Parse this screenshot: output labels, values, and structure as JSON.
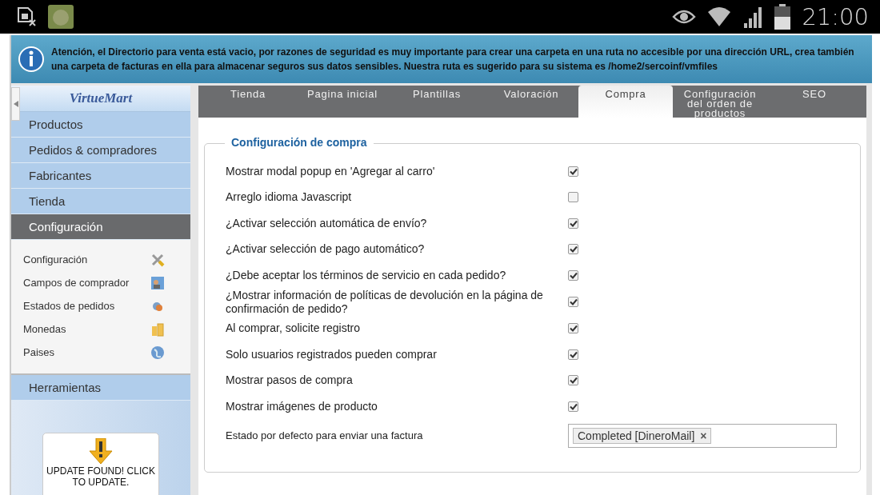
{
  "status_bar": {
    "time": "21:00"
  },
  "notice": {
    "text": "Atención, el Directorio para venta está vacio, por razones de seguridad es muy importante para crear una carpeta en una ruta no accesible por una dirección URL, crea también una carpeta de facturas en ella para almacenar seguros sus datos sensibles. Nuestra ruta es sugerido para su sistema es /home2/sercoinf/vmfiles"
  },
  "sidebar": {
    "logo": "VirtueMart",
    "items": [
      {
        "label": "Productos",
        "selected": false
      },
      {
        "label": "Pedidos & compradores",
        "selected": false
      },
      {
        "label": "Fabricantes",
        "selected": false
      },
      {
        "label": "Tienda",
        "selected": false
      },
      {
        "label": "Configuración",
        "selected": true,
        "children": [
          {
            "label": "Configuración"
          },
          {
            "label": "Campos de comprador"
          },
          {
            "label": "Estados de pedidos"
          },
          {
            "label": "Monedas"
          },
          {
            "label": "Paises"
          }
        ]
      },
      {
        "label": "Herramientas",
        "selected": false
      }
    ],
    "update": {
      "text": "UPDATE FOUND! CLICK TO UPDATE."
    }
  },
  "tabs": [
    {
      "label": "Tienda",
      "selected": false
    },
    {
      "label": "Pagina inicial",
      "selected": false
    },
    {
      "label": "Plantillas",
      "selected": false
    },
    {
      "label": "Valoración",
      "selected": false
    },
    {
      "label": "Compra",
      "selected": true
    },
    {
      "label": "Configuración del orden de productos",
      "selected": false
    },
    {
      "label": "SEO",
      "selected": false
    }
  ],
  "section": {
    "title": "Configuración de compra",
    "rows": [
      {
        "kind": "checkbox",
        "label": "Mostrar modal popup en 'Agregar al carro'",
        "checked": true
      },
      {
        "kind": "checkbox",
        "label": "Arreglo idioma Javascript",
        "checked": false
      },
      {
        "kind": "checkbox",
        "label": "¿Activar selección automática de envío?",
        "checked": true
      },
      {
        "kind": "checkbox",
        "label": "¿Activar selección de pago automático?",
        "checked": true
      },
      {
        "kind": "checkbox",
        "label": "¿Debe aceptar los términos de servicio en cada pedido?",
        "checked": true
      },
      {
        "kind": "checkbox",
        "label": "¿Mostrar información de políticas de devolución en la página de confirmación de pedido?",
        "checked": true
      },
      {
        "kind": "checkbox",
        "label": "Al comprar, solicite registro",
        "checked": true
      },
      {
        "kind": "checkbox",
        "label": "Solo usuarios registrados pueden comprar",
        "checked": true
      },
      {
        "kind": "checkbox",
        "label": "Mostrar pasos de compra",
        "checked": true
      },
      {
        "kind": "checkbox",
        "label": "Mostrar imágenes de producto",
        "checked": true
      },
      {
        "kind": "tags",
        "label": "Estado por defecto para enviar una factura",
        "tags": [
          "Completed [DineroMail]"
        ],
        "remove": "×"
      }
    ]
  }
}
